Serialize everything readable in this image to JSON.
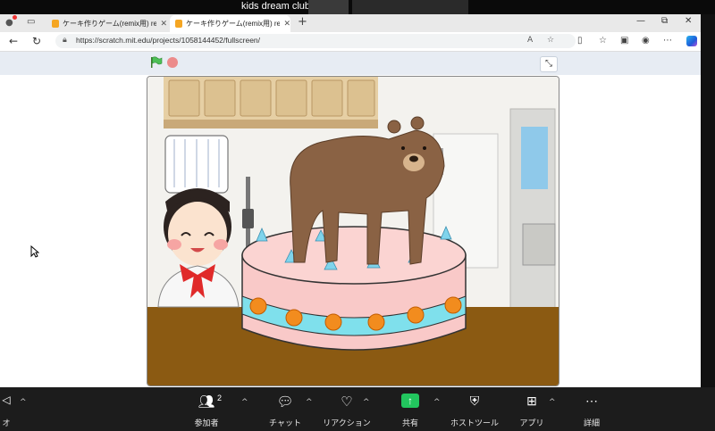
{
  "meeting": {
    "title": "kids dream club"
  },
  "browser": {
    "tabs": [
      {
        "title": "ケーキ作りゲーム(remix用) remix on",
        "active": false
      },
      {
        "title": "ケーキ作りゲーム(remix用) remix on",
        "active": true
      }
    ],
    "new_tab": "+",
    "window_controls": {
      "minimize": "—",
      "maximize": "⧉",
      "close": "✕"
    },
    "url": "https://scratch.mit.edu/projects/1058144452/fullscreen/"
  },
  "scratch": {
    "green_flag": "green-flag-icon",
    "stop": "stop-icon",
    "fullscreen_exit": "exit-fullscreen-icon"
  },
  "taskbar": {
    "left_label": "オ",
    "participants_label": "参加者",
    "participants_count": "2",
    "chat_label": "チャット",
    "reactions_label": "リアクション",
    "share_label": "共有",
    "host_tools_label": "ホストツール",
    "apps_label": "アプリ",
    "more_label": "詳細"
  },
  "colors": {
    "share_green": "#22c55e",
    "cake_pink": "#f9c9c8",
    "frosting_cyan": "#7fe0ec",
    "bear_brown": "#8a6244",
    "floor_brown": "#8b5a12"
  }
}
